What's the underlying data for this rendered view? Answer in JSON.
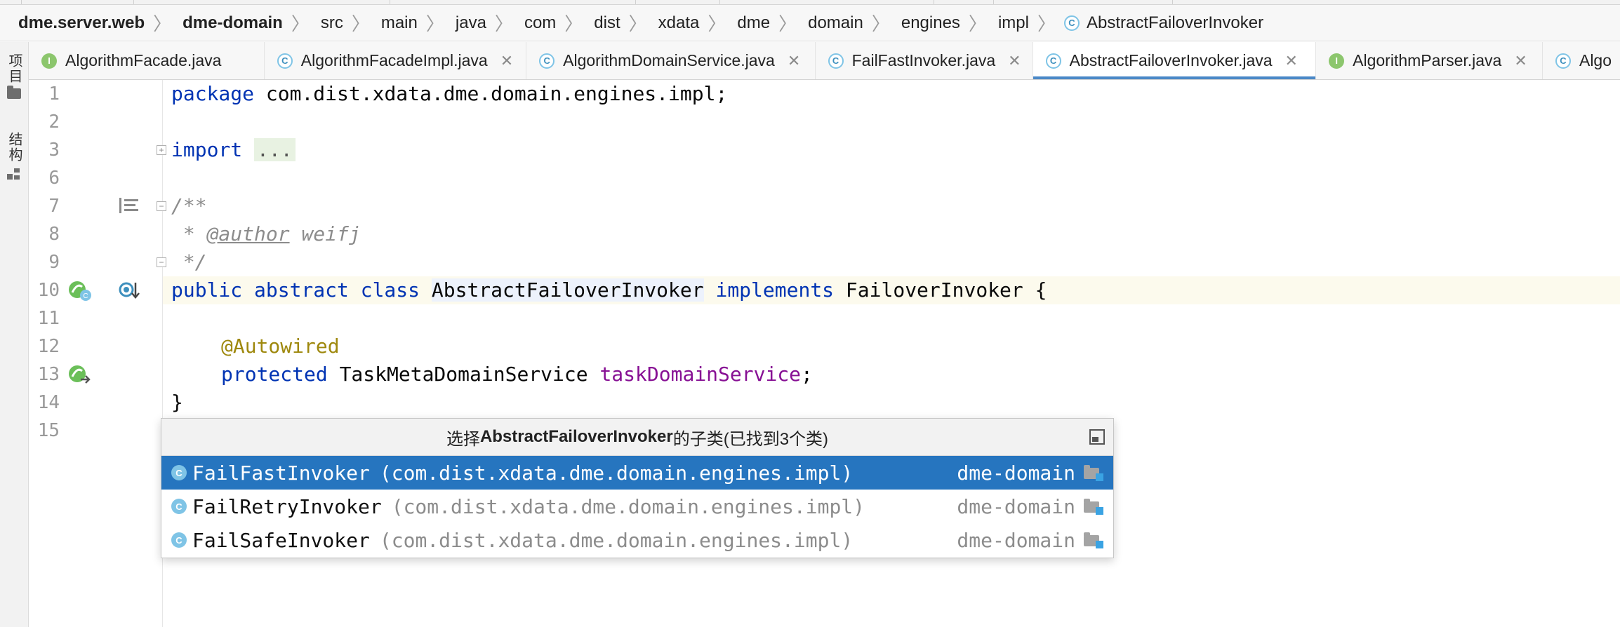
{
  "breadcrumb": [
    {
      "label": "dme.server.web",
      "bold": true
    },
    {
      "label": "dme-domain",
      "bold": true
    },
    {
      "label": "src"
    },
    {
      "label": "main"
    },
    {
      "label": "java"
    },
    {
      "label": "com"
    },
    {
      "label": "dist"
    },
    {
      "label": "xdata"
    },
    {
      "label": "dme"
    },
    {
      "label": "domain"
    },
    {
      "label": "engines"
    },
    {
      "label": "impl"
    },
    {
      "label": "AbstractFailoverInvoker",
      "icon": "class-icon"
    }
  ],
  "tool_strip": {
    "project_label": "项目",
    "structure_label": "结构"
  },
  "tabs": [
    {
      "label": "AlgorithmFacade.java",
      "icon": "interface-icon",
      "close": false
    },
    {
      "label": "AlgorithmFacadeImpl.java",
      "icon": "class-icon",
      "close": true
    },
    {
      "label": "AlgorithmDomainService.java",
      "icon": "class-icon",
      "close": true
    },
    {
      "label": "FailFastInvoker.java",
      "icon": "class-icon",
      "close": true
    },
    {
      "label": "AbstractFailoverInvoker.java",
      "icon": "abstract-class-icon",
      "close": true,
      "active": true
    },
    {
      "label": "AlgorithmParser.java",
      "icon": "interface-icon",
      "close": true
    },
    {
      "label": "Algo",
      "icon": "class-icon",
      "close": false
    }
  ],
  "code": {
    "line_numbers": [
      "1",
      "2",
      "3",
      "6",
      "7",
      "8",
      "9",
      "10",
      "11",
      "12",
      "13",
      "14",
      "15"
    ],
    "line1": {
      "kw": "package",
      "rest": " com.dist.xdata.dme.domain.engines.impl;"
    },
    "line3": {
      "kw": "import",
      "dots": "..."
    },
    "line7": "/**",
    "line8": {
      "prefix": " * ",
      "tag": "@author",
      "rest": " weifj"
    },
    "line9": " */",
    "line10": {
      "kw1": "public abstract class",
      "cls": "AbstractFailoverInvoker",
      "kw2": "implements",
      "rest": " FailoverInvoker {"
    },
    "line12": "@Autowired",
    "line13": {
      "kw": "protected",
      "type": " TaskMetaDomainService ",
      "field": "taskDomainService",
      "end": ";"
    },
    "line14": "}"
  },
  "popup": {
    "title_prefix": "选择",
    "title_class": "AbstractFailoverInvoker",
    "title_suffix": "的子类(已找到3个类)",
    "rows": [
      {
        "name": "FailFastInvoker",
        "package": "(com.dist.xdata.dme.domain.engines.impl)",
        "module": "dme-domain",
        "selected": true
      },
      {
        "name": "FailRetryInvoker",
        "package": "(com.dist.xdata.dme.domain.engines.impl)",
        "module": "dme-domain"
      },
      {
        "name": "FailSafeInvoker",
        "package": "(com.dist.xdata.dme.domain.engines.impl)",
        "module": "dme-domain"
      }
    ]
  },
  "colors": {
    "keyword": "#0033b3",
    "comment": "#8c8c8c",
    "annotation": "#9e880d",
    "field": "#871094",
    "selection": "#2675bf",
    "active_tab_underline": "#4a88c7"
  }
}
